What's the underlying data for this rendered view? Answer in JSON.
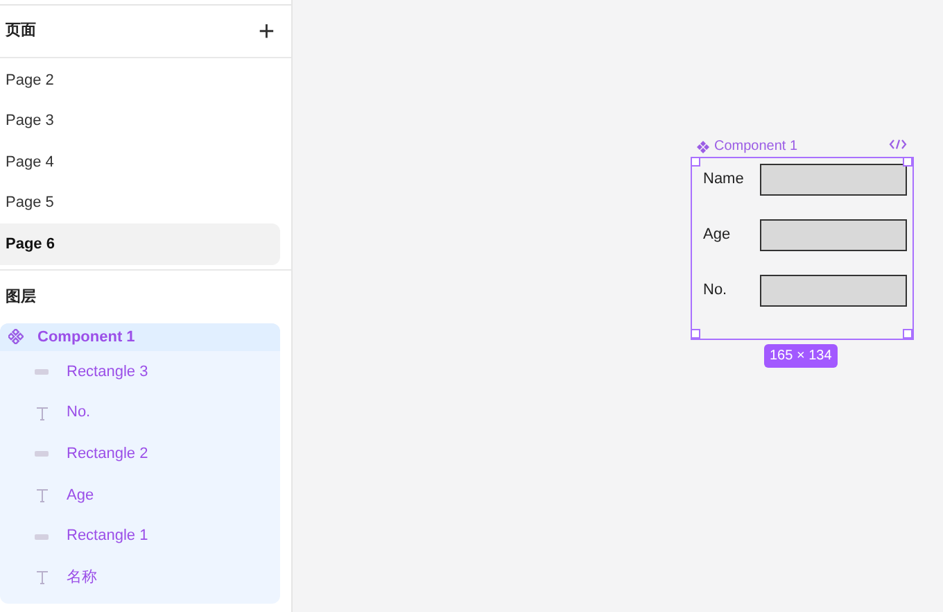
{
  "pages_panel": {
    "title": "页面",
    "add_button": "+",
    "pages": [
      {
        "label": "Page 2",
        "selected": false
      },
      {
        "label": "Page 3",
        "selected": false
      },
      {
        "label": "Page 4",
        "selected": false
      },
      {
        "label": "Page 5",
        "selected": false
      },
      {
        "label": "Page 6",
        "selected": true
      }
    ]
  },
  "layers_panel": {
    "title": "图层",
    "layers": [
      {
        "label": "Component 1",
        "kind": "component",
        "selected": true,
        "children": [
          {
            "label": "Rectangle 3",
            "kind": "rectangle"
          },
          {
            "label": "No.",
            "kind": "text"
          },
          {
            "label": "Rectangle 2",
            "kind": "rectangle"
          },
          {
            "label": "Age",
            "kind": "text"
          },
          {
            "label": "Rectangle 1",
            "kind": "rectangle"
          },
          {
            "label": "名称",
            "kind": "text"
          }
        ]
      }
    ]
  },
  "canvas": {
    "component": {
      "name": "Component 1",
      "fields": [
        {
          "label": "Name"
        },
        {
          "label": "Age"
        },
        {
          "label": "No."
        }
      ],
      "size": "165 × 134"
    }
  }
}
